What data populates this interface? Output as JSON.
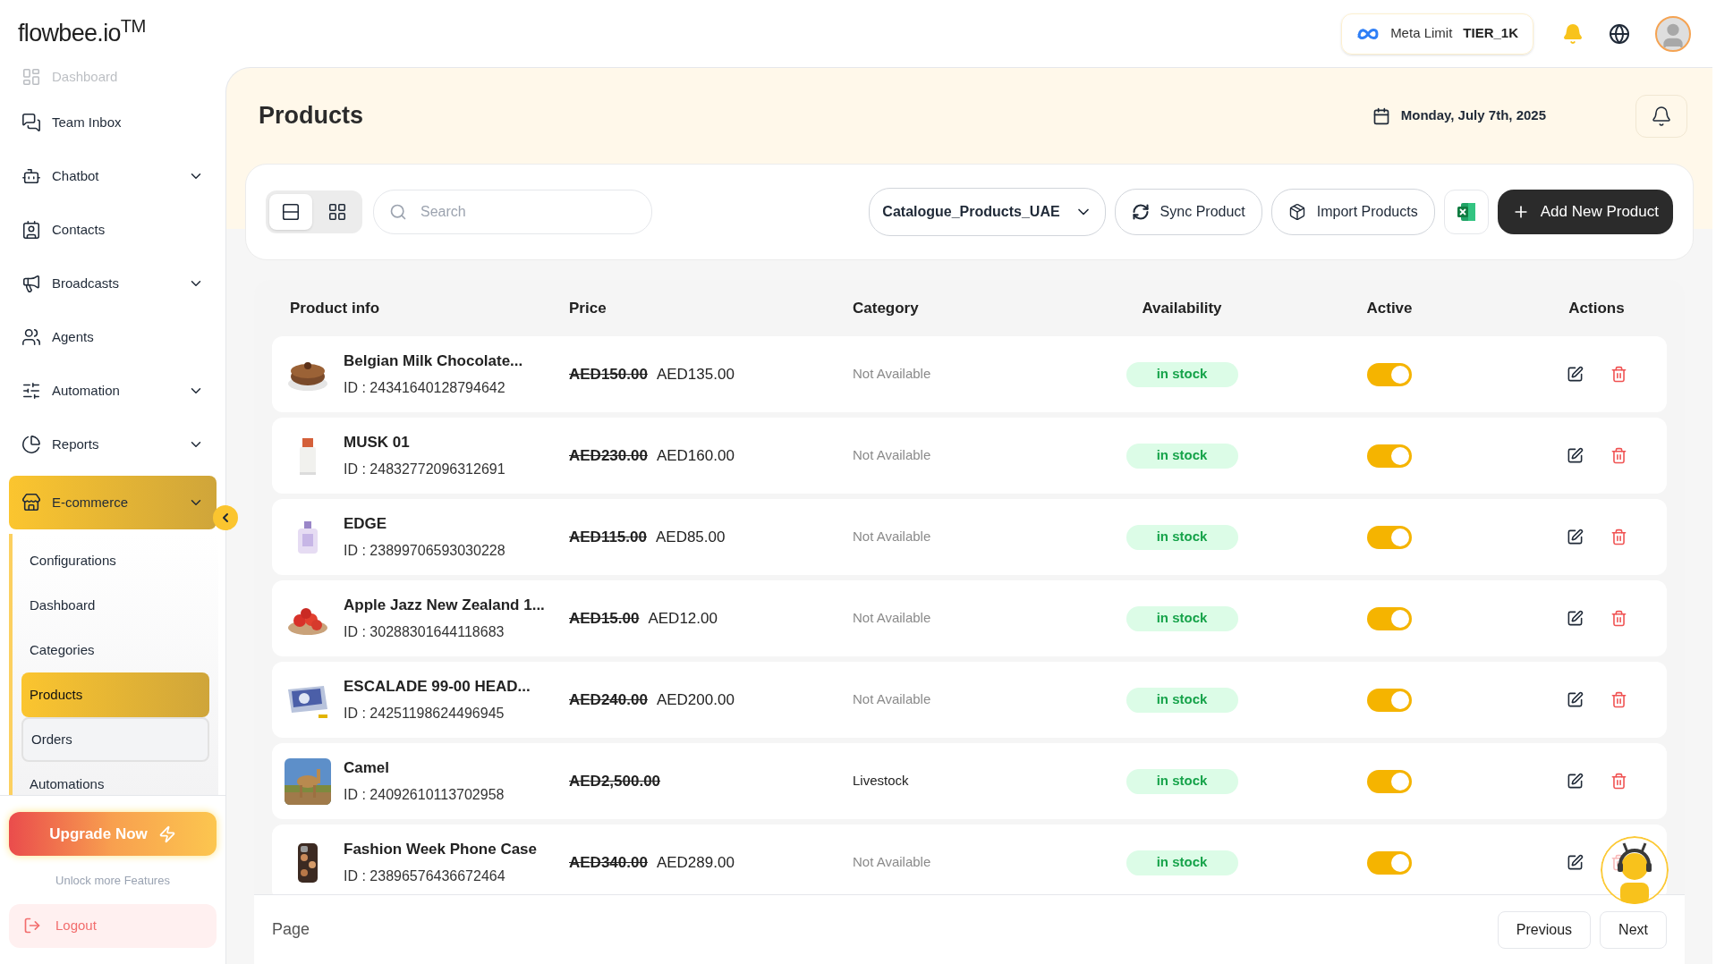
{
  "header": {
    "logo": "flowbee.io$^{TM}$",
    "meta_limit": {
      "label": "Meta Limit",
      "value": "TIER_1K"
    }
  },
  "sidebar": {
    "items": [
      {
        "label": "Dashboard",
        "kind": "link",
        "selected": false,
        "faded": true
      },
      {
        "label": "Team Inbox",
        "kind": "link",
        "selected": false,
        "faded": false
      },
      {
        "label": "Chatbot",
        "kind": "dropdown",
        "selected": false,
        "faded": false
      },
      {
        "label": "Contacts",
        "kind": "link",
        "selected": false,
        "faded": false
      },
      {
        "label": "Broadcasts",
        "kind": "dropdown",
        "selected": false,
        "faded": false
      },
      {
        "label": "Agents",
        "kind": "link",
        "selected": false,
        "faded": false
      },
      {
        "label": "Automation",
        "kind": "dropdown",
        "selected": false,
        "faded": false
      },
      {
        "label": "Reports",
        "kind": "dropdown",
        "selected": false,
        "faded": false
      },
      {
        "label": "E-commerce",
        "kind": "dropdown",
        "selected": true,
        "faded": false,
        "children": [
          {
            "label": "Configurations",
            "selected": false,
            "hovered": false
          },
          {
            "label": "Dashboard",
            "selected": false,
            "hovered": false
          },
          {
            "label": "Categories",
            "selected": false,
            "hovered": false
          },
          {
            "label": "Products",
            "selected": true,
            "hovered": false
          },
          {
            "label": "Orders",
            "selected": false,
            "hovered": true
          },
          {
            "label": "Automations",
            "selected": false,
            "hovered": false
          }
        ]
      }
    ],
    "upgrade": {
      "label": "Upgrade Now",
      "note": "Unlock more Features"
    },
    "logout": "Logout"
  },
  "page": {
    "title": "Products",
    "date": "Monday, July 7th, 2025"
  },
  "toolbar": {
    "view_modes": [
      {
        "selected": true
      },
      {
        "selected": false
      }
    ],
    "search_placeholder": "Search",
    "catalogue": "Catalogue_Products_UAE",
    "buttons": [
      "Sync Product",
      "Import Products"
    ],
    "add_button": "Add New Product"
  },
  "table": {
    "columns": [
      "Product info",
      "Price",
      "Category",
      "Availability",
      "Active",
      "Actions"
    ],
    "rows": [
      {
        "name": "Belgian Milk Chocolate...",
        "id": "ID : 24341640128794642",
        "old_price": "AED150.00",
        "price": "AED135.00",
        "category": "Not Available",
        "category_missing": true,
        "availability": "in stock",
        "active": true
      },
      {
        "name": "MUSK 01",
        "id": "ID : 24832772096312691",
        "old_price": "AED230.00",
        "price": "AED160.00",
        "category": "Not Available",
        "category_missing": true,
        "availability": "in stock",
        "active": true
      },
      {
        "name": "EDGE",
        "id": "ID : 23899706593030228",
        "old_price": "AED115.00",
        "price": "AED85.00",
        "category": "Not Available",
        "category_missing": true,
        "availability": "in stock",
        "active": true
      },
      {
        "name": "Apple Jazz New Zealand 1...",
        "id": "ID : 30288301644118683",
        "old_price": "AED15.00",
        "price": "AED12.00",
        "category": "Not Available",
        "category_missing": true,
        "availability": "in stock",
        "active": true
      },
      {
        "name": "ESCALADE 99-00 HEAD...",
        "id": "ID : 24251198624496945",
        "old_price": "AED240.00",
        "price": "AED200.00",
        "category": "Not Available",
        "category_missing": true,
        "availability": "in stock",
        "active": true
      },
      {
        "name": "Camel",
        "id": "ID : 24092610113702958",
        "old_price": "AED2,500.00",
        "category": "Livestock",
        "category_missing": false,
        "availability": "in stock",
        "active": true
      },
      {
        "name": "Fashion Week Phone Case",
        "id": "ID : 23896576436672464",
        "old_price": "AED340.00",
        "price": "AED289.00",
        "category": "Not Available",
        "category_missing": true,
        "availability": "in stock",
        "active": true
      }
    ]
  },
  "pagination": {
    "label": "Page",
    "buttons": [
      "Previous",
      "Next"
    ]
  }
}
